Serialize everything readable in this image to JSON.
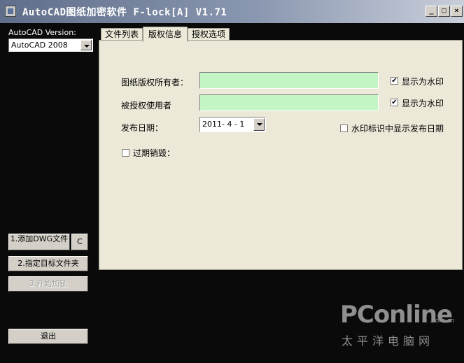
{
  "window": {
    "title": "AutoCAD图纸加密软件 F-lock[A] V1.71",
    "minimize_glyph": "_",
    "maximize_glyph": "□",
    "close_glyph": "×"
  },
  "sidebar": {
    "version_label": "AutoCAD Version:",
    "version_value": "AutoCAD 2008",
    "add_dwg_label": "1.添加DWG文件",
    "c_label": "C",
    "target_folder_label": "2.指定目标文件夹",
    "start_encrypt_label": "3.开始加锁",
    "exit_label": "退出"
  },
  "tabs": [
    {
      "label": "文件列表"
    },
    {
      "label": "版权信息"
    },
    {
      "label": "授权选项"
    }
  ],
  "form": {
    "owner_label": "图纸版权所有者：",
    "owner_value": "",
    "owner_watermark_label": "显示为水印",
    "owner_watermark_checked": true,
    "licensee_label": "被授权使用者",
    "licensee_value": "",
    "licensee_watermark_label": "显示为水印",
    "licensee_watermark_checked": true,
    "date_label": "发布日期：",
    "date_value": "2011- 4 - 1",
    "show_date_label": "水印标识中显示发布日期",
    "show_date_checked": false,
    "expire_label": "过期销毁：",
    "expire_checked": false
  },
  "watermark": {
    "brand": "PConline",
    "domain": ".com.cn",
    "cn": "太平洋电脑网"
  },
  "colors": {
    "field_bg": "#c4f5c4",
    "panel_bg": "#ece9d8",
    "app_bg": "#0a0a0a"
  }
}
